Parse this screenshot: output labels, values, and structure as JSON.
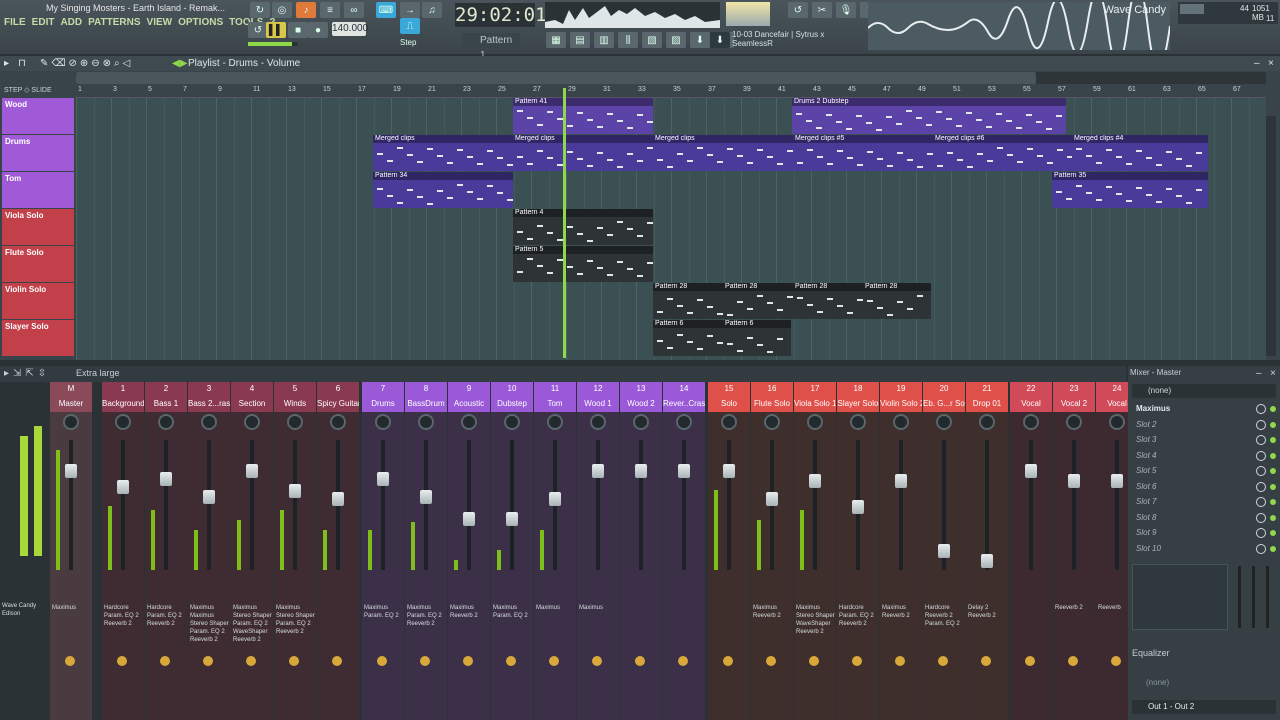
{
  "window": {
    "title": "My Singing Mosters - Earth Island - Remak..."
  },
  "menu": [
    "FILE",
    "EDIT",
    "ADD",
    "PATTERNS",
    "VIEW",
    "OPTIONS",
    "TOOLS",
    "?"
  ],
  "transport": {
    "time": "29:02:01",
    "bpm": "140.000",
    "pattern": "Pattern 1",
    "snap": "Step"
  },
  "hint": {
    "line1": "10-03  Dancefair | Sytrus x",
    "line2": "SeamlessR"
  },
  "wave_candy": "Wave Candy",
  "cpu": {
    "cpu": "44",
    "mem": "1051 MB",
    "poly": "11"
  },
  "playlist": {
    "title": "Playlist - Drums - Volume",
    "ruler": [
      "1",
      "3",
      "5",
      "7",
      "9",
      "11",
      "13",
      "15",
      "17",
      "19",
      "21",
      "23",
      "25",
      "27",
      "29",
      "31",
      "33",
      "35",
      "37",
      "39",
      "41",
      "43",
      "45",
      "47",
      "49",
      "51",
      "53",
      "55",
      "57",
      "59",
      "61",
      "63",
      "65",
      "67"
    ],
    "tracks": [
      {
        "name": "Wood",
        "color": "#a05ad8"
      },
      {
        "name": "Drums",
        "color": "#a05ad8"
      },
      {
        "name": "Tom",
        "color": "#a05ad8"
      },
      {
        "name": "Viola Solo",
        "color": "#c2404a"
      },
      {
        "name": "Flute Solo",
        "color": "#c2404a"
      },
      {
        "name": "Violin Solo",
        "color": "#c2404a"
      },
      {
        "name": "Slayer Solo",
        "color": "#c2404a"
      }
    ],
    "clips": [
      {
        "label": "Pattern 41"
      },
      {
        "label": "Drums 2 Dubstep"
      },
      {
        "label": "Merged clips"
      },
      {
        "label": "Merged clips"
      },
      {
        "label": "Merged clips"
      },
      {
        "label": "Merged clips #5"
      },
      {
        "label": "Merged clips #6"
      },
      {
        "label": "Merged clips #4"
      },
      {
        "label": "Pattern 34"
      },
      {
        "label": "Pattern 35"
      },
      {
        "label": "Pattern 4"
      },
      {
        "label": "Pattern 5"
      },
      {
        "label": "Pattern 28"
      },
      {
        "label": "Pattern 28"
      },
      {
        "label": "Pattern 28"
      },
      {
        "label": "Pattern 28"
      },
      {
        "label": "Pattern 6"
      },
      {
        "label": "Pattern 6"
      }
    ]
  },
  "mixer": {
    "title": "Extra large",
    "master_title": "Mixer - Master",
    "insert_label": "Wave Candy\nEdison",
    "master_fx": "Maximus",
    "strips": [
      {
        "label": "Master",
        "num": "M",
        "fx": "Maximus"
      },
      {
        "label": "Background",
        "num": "1",
        "fx": "Hardcore\nParam. EQ 2\nReeverb 2"
      },
      {
        "label": "Bass 1",
        "num": "2",
        "fx": "Hardcore\nParam. EQ 2\nReeverb 2"
      },
      {
        "label": "Bass 2...rass",
        "num": "3",
        "fx": "Maximus\nMaximus\nStereo Shaper\nParam. EQ 2\nReeverb 2"
      },
      {
        "label": "Section",
        "num": "4",
        "fx": "Maximus\nStereo Shaper\nParam. EQ 2\nWaveShaper\nReeverb 2"
      },
      {
        "label": "Winds",
        "num": "5",
        "fx": "Maximus\nStereo Shaper\nParam. EQ 2\nReeverb 2"
      },
      {
        "label": "Spicy Guitar",
        "num": "6",
        "fx": ""
      },
      {
        "label": "Drums",
        "num": "7",
        "fx": "Maximus\nParam. EQ 2"
      },
      {
        "label": "BassDrum",
        "num": "8",
        "fx": "Maximus\nParam. EQ 2\nReeverb 2"
      },
      {
        "label": "Acoustic",
        "num": "9",
        "fx": "Maximus\nReeverb 2"
      },
      {
        "label": "Dubstep",
        "num": "10",
        "fx": "Maximus\nParam. EQ 2"
      },
      {
        "label": "Tom",
        "num": "11",
        "fx": "Maximus"
      },
      {
        "label": "Wood 1",
        "num": "12",
        "fx": "Maximus"
      },
      {
        "label": "Wood 2",
        "num": "13",
        "fx": ""
      },
      {
        "label": "Rever..Crash",
        "num": "14",
        "fx": ""
      },
      {
        "label": "Solo",
        "num": "15",
        "fx": ""
      },
      {
        "label": "Flute Solo",
        "num": "16",
        "fx": "Maximus\nReeverb 2"
      },
      {
        "label": "Viola Solo 1",
        "num": "17",
        "fx": "Maximus\nStereo Shaper\nWaveShaper\nReeverb 2"
      },
      {
        "label": "Slayer Solo",
        "num": "18",
        "fx": "Hardcore\nParam. EQ 2\nReeverb 2"
      },
      {
        "label": "Violin Solo 2",
        "num": "19",
        "fx": "Maximus\nReeverb 2"
      },
      {
        "label": "Eb. G...r Solo",
        "num": "20",
        "fx": "Hardcore\nReeverb 2\nParam. EQ 2"
      },
      {
        "label": "Drop 01",
        "num": "21",
        "fx": "Delay 2\nReeverb 2"
      },
      {
        "label": "Vocal",
        "num": "22",
        "fx": ""
      },
      {
        "label": "Vocal 2",
        "num": "23",
        "fx": "Reeverb 2"
      },
      {
        "label": "Vocal",
        "num": "24",
        "fx": "Reeverb"
      }
    ],
    "slots": [
      "(none)",
      "Maximus",
      "Slot 2",
      "Slot 3",
      "Slot 4",
      "Slot 5",
      "Slot 6",
      "Slot 7",
      "Slot 8",
      "Slot 9",
      "Slot 10"
    ],
    "eq_label": "Equalizer",
    "output_none": "(none)",
    "output": "Out 1 - Out 2"
  }
}
